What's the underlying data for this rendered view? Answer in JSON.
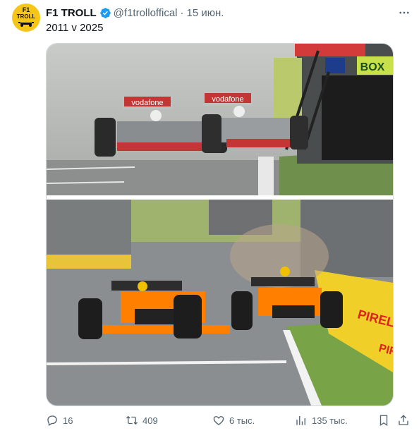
{
  "author": {
    "logo_line1": "F1",
    "logo_line2": "TROLL",
    "name": "F1 TROLL",
    "handle": "@f1trolloffical",
    "separator": "·",
    "date": "15 июн."
  },
  "tweet": {
    "text": "2011 v 2025",
    "photo_top_signs": [
      "vodafone",
      "vodafone",
      "BOX"
    ],
    "photo_bottom_signs": [
      "PIRELLI",
      "PIRELLI"
    ]
  },
  "actions": {
    "replies": "16",
    "retweets": "409",
    "likes": "6 тыс.",
    "views": "135 тыс."
  },
  "colors": {
    "accent": "#1d9bf0",
    "papaya": "#ff8000",
    "secondary_text": "#536471"
  },
  "icons": [
    "verified-badge-icon",
    "more-icon",
    "reply-icon",
    "retweet-icon",
    "like-icon",
    "views-icon",
    "bookmark-icon",
    "share-icon"
  ]
}
